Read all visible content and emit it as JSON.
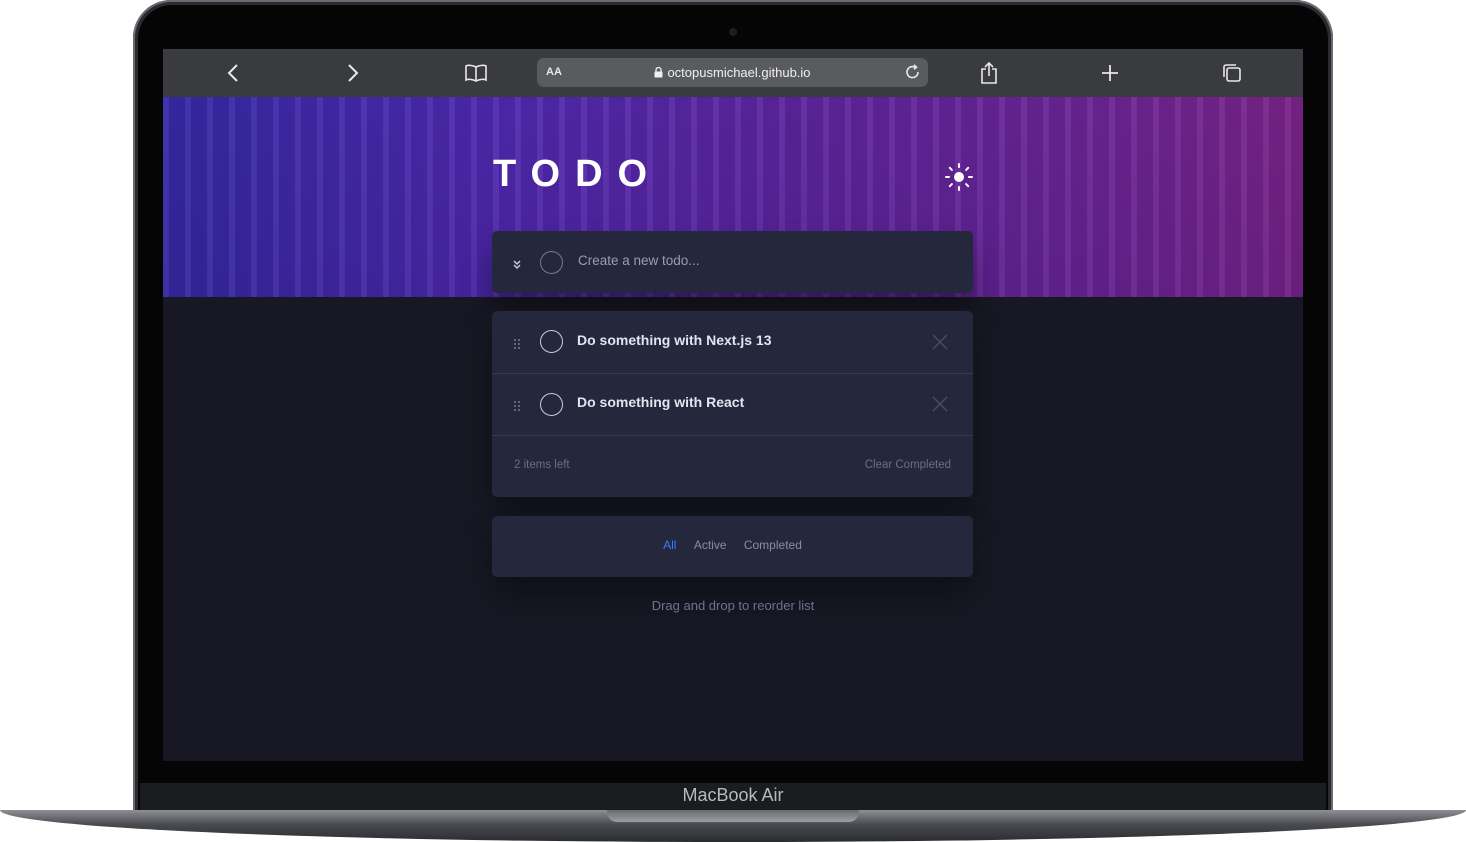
{
  "device": {
    "brand": "MacBook Air"
  },
  "browser": {
    "url": "octopusmichael.github.io",
    "reader_label": "AA",
    "icons": [
      "back-icon",
      "forward-icon",
      "bookmarks-icon",
      "lock-icon",
      "reload-icon",
      "share-icon",
      "new-tab-icon",
      "tabs-icon"
    ]
  },
  "app": {
    "title": "TODO",
    "theme_icon": "sun-icon",
    "create_placeholder": "Create a new todo...",
    "todos": [
      {
        "text": "Do something with Next.js 13",
        "completed": false
      },
      {
        "text": "Do something with React",
        "completed": false
      }
    ],
    "items_left": "2 items left",
    "clear_label": "Clear Completed",
    "filters": [
      {
        "label": "All",
        "active": true
      },
      {
        "label": "Active",
        "active": false
      },
      {
        "label": "Completed",
        "active": false
      }
    ],
    "hint": "Drag and drop to reorder list"
  },
  "colors": {
    "accent": "#3a7cfd",
    "card": "#25273d",
    "background": "#171823"
  }
}
